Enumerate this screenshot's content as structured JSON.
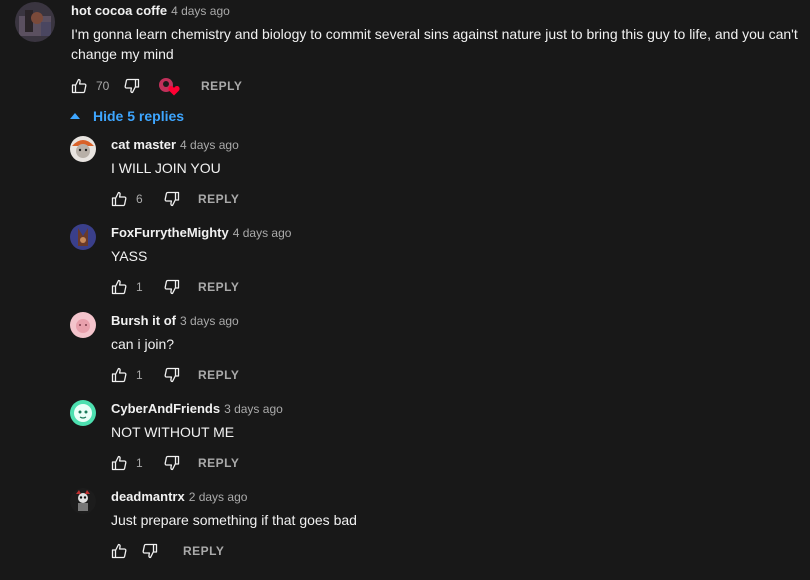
{
  "main_comment": {
    "author": "hot cocoa coffe",
    "time": "4 days ago",
    "text": "I'm gonna learn chemistry and biology to commit several sins against nature just to bring this guy to life, and you can't change my mind",
    "likes": "70",
    "reply_label": "REPLY"
  },
  "replies_toggle": "Hide 5 replies",
  "replies": [
    {
      "author": "cat master",
      "time": "4 days ago",
      "text": "I  WILL JOIN YOU",
      "likes": "6",
      "reply_label": "REPLY"
    },
    {
      "author": "FoxFurrytheMighty",
      "time": "4 days ago",
      "text": "YASS",
      "likes": "1",
      "reply_label": "REPLY"
    },
    {
      "author": "Bursh it of",
      "time": "3 days ago",
      "text": "can i join?",
      "likes": "1",
      "reply_label": "REPLY"
    },
    {
      "author": "CyberAndFriends",
      "time": "3 days ago",
      "text": "NOT WITHOUT ME",
      "likes": "1",
      "reply_label": "REPLY"
    },
    {
      "author": "deadmantrx",
      "time": "2 days ago",
      "text": "Just prepare something if that goes bad",
      "likes": "",
      "reply_label": "REPLY"
    }
  ],
  "colors": {
    "background": "#181818",
    "text": "#f1f1f1",
    "muted": "#aaaaaa",
    "link": "#3ea6ff",
    "heart": "#ff0033"
  }
}
